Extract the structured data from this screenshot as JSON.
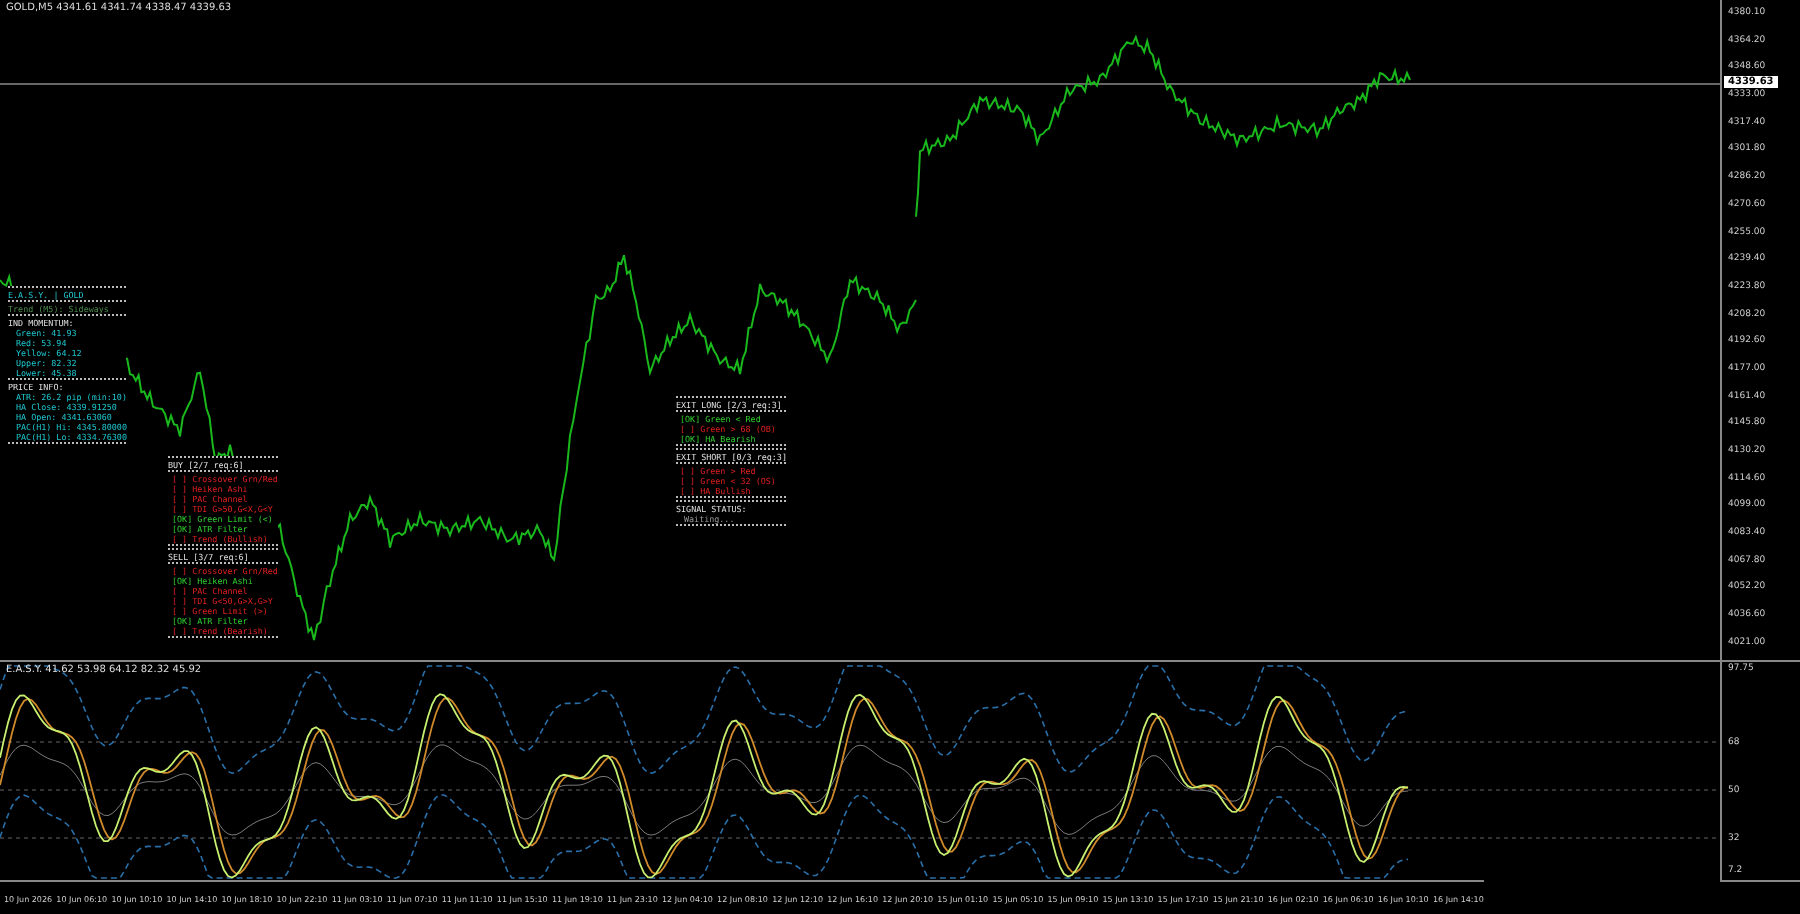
{
  "chart": {
    "title": "GOLD,M5 4341.61 4341.74 4338.47 4339.63",
    "current_price": "4339.63",
    "price_axis": [
      "4380.10",
      "4364.20",
      "4348.60",
      "4333.00",
      "4317.40",
      "4301.80",
      "4286.20",
      "4270.60",
      "4255.00",
      "4239.40",
      "4223.80",
      "4208.20",
      "4192.60",
      "4177.00",
      "4161.40",
      "4145.80",
      "4130.20",
      "4114.60",
      "4099.00",
      "4083.40",
      "4067.80",
      "4052.20",
      "4036.60",
      "4021.00"
    ]
  },
  "info_panel": {
    "title": "E.A.S.Y. | GOLD",
    "trend": "Trend (M5): Sideways",
    "momentum_heading": "IND MOMENTUM:",
    "momentum": [
      "Green: 41.93",
      "Red: 53.94",
      "Yellow: 64.12",
      "Upper: 82.32",
      "Lower: 45.38"
    ],
    "price_heading": "PRICE INFO:",
    "price_info": [
      "ATR: 26.2 pip (min:10)",
      "HA Close: 4339.91250",
      "HA Open: 4341.63060",
      "PAC(H1) Hi: 4345.80000",
      "PAC(H1) Lo: 4334.76300"
    ]
  },
  "buy_panel": {
    "title": "BUY [2/7 req:6]",
    "conditions": [
      {
        "text": "[  ] Crossover Grn/Red",
        "ok": false
      },
      {
        "text": "[  ] Heiken Ashi",
        "ok": false
      },
      {
        "text": "[  ] PAC Channel",
        "ok": false
      },
      {
        "text": "[  ] TDI G>50,G<X,G<Y",
        "ok": false
      },
      {
        "text": "[OK] Green Limit (<)",
        "ok": true
      },
      {
        "text": "[OK] ATR Filter",
        "ok": true
      },
      {
        "text": "[  ] Trend (Bullish)",
        "ok": false
      }
    ]
  },
  "sell_panel": {
    "title": "SELL [3/7 req:6]",
    "conditions": [
      {
        "text": "[  ] Crossover Grn/Red",
        "ok": false
      },
      {
        "text": "[OK] Heiken Ashi",
        "ok": true
      },
      {
        "text": "[  ] PAC Channel",
        "ok": false
      },
      {
        "text": "[  ] TDI G<50,G>X,G>Y",
        "ok": false
      },
      {
        "text": "[  ] Green Limit (>)",
        "ok": false
      },
      {
        "text": "[OK] ATR Filter",
        "ok": true
      },
      {
        "text": "[  ] Trend (Bearish)",
        "ok": false
      }
    ]
  },
  "exit_long_panel": {
    "title": "EXIT LONG [2/3 req:3]",
    "conditions": [
      {
        "text": "[OK] Green < Red",
        "ok": true
      },
      {
        "text": "[  ] Green > 68 (OB)",
        "ok": false
      },
      {
        "text": "[OK] HA Bearish",
        "ok": true
      }
    ]
  },
  "exit_short_panel": {
    "title": "EXIT SHORT [0/3 req:3]",
    "conditions": [
      {
        "text": "[  ] Green > Red",
        "ok": false
      },
      {
        "text": "[  ] Green < 32 (OS)",
        "ok": false
      },
      {
        "text": "[  ] HA Bullish",
        "ok": false
      }
    ]
  },
  "signal": {
    "heading": "SIGNAL STATUS:",
    "status": "Waiting..."
  },
  "indicator": {
    "title": "E.A.S.Y. 41.62 53.98 64.12 82.32 45.92",
    "axis": [
      "97.75",
      "68",
      "50",
      "32",
      "7.2"
    ]
  },
  "time_axis": [
    "10 Jun 2026",
    "10 Jun 06:10",
    "10 Jun 10:10",
    "10 Jun 14:10",
    "10 Jun 18:10",
    "10 Jun 22:10",
    "11 Jun 03:10",
    "11 Jun 07:10",
    "11 Jun 11:10",
    "11 Jun 15:10",
    "11 Jun 19:10",
    "11 Jun 23:10",
    "12 Jun 04:10",
    "12 Jun 08:10",
    "12 Jun 12:10",
    "12 Jun 16:10",
    "12 Jun 20:10",
    "15 Jun 01:10",
    "15 Jun 05:10",
    "15 Jun 09:10",
    "15 Jun 13:10",
    "15 Jun 17:10",
    "15 Jun 21:10",
    "16 Jun 02:10",
    "16 Jun 06:10",
    "16 Jun 10:10",
    "16 Jun 14:10"
  ]
}
